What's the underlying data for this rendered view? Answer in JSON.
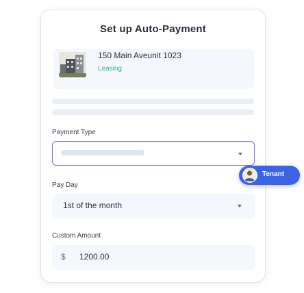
{
  "title": "Set up Auto-Payment",
  "property": {
    "address": "150 Main Aveunit 1023",
    "status": "Leasing"
  },
  "payment_type": {
    "label": "Payment Type",
    "value": ""
  },
  "tenant_badge": {
    "label": "Tenant",
    "color": "#3b63e6"
  },
  "pay_day": {
    "label": "Pay Day",
    "value": "1st of the month"
  },
  "custom_amount": {
    "label": "Custom Amount",
    "currency": "$",
    "value": "1200.00"
  },
  "colors": {
    "accent": "#7b6ff0",
    "status": "#3aa6a0",
    "field_bg": "#f4f7fb"
  }
}
